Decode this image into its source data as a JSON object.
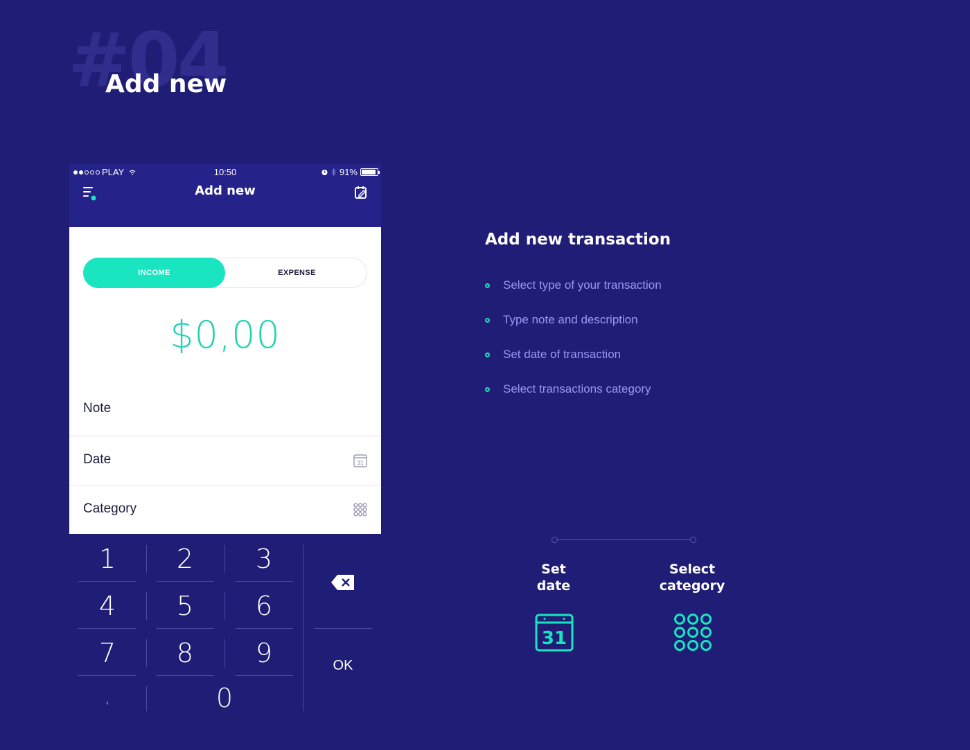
{
  "header": {
    "background_number": "#04",
    "title": "Add new"
  },
  "phone": {
    "status": {
      "carrier": "PLAY",
      "time": "10:50",
      "battery": "91%"
    },
    "nav_title": "Add new",
    "toggle": {
      "income": "INCOME",
      "expense": "EXPENSE",
      "selected": "INCOME"
    },
    "amount": "$0,00",
    "fields": {
      "note": "Note",
      "date": "Date",
      "category": "Category"
    },
    "date_icon_day": "31",
    "keypad": {
      "k1": "1",
      "k2": "2",
      "k3": "3",
      "k4": "4",
      "k5": "5",
      "k6": "6",
      "k7": "7",
      "k8": "8",
      "k9": "9",
      "comma": ",",
      "k0": "0",
      "ok": "OK"
    }
  },
  "info": {
    "title": "Add new transaction",
    "bullets": [
      "Select type of your transaction",
      "Type note and description",
      "Set date of transaction",
      "Select transactions category"
    ]
  },
  "steps": {
    "date": {
      "line1": "Set",
      "line2": "date",
      "icon_day": "31"
    },
    "category": {
      "line1": "Select",
      "line2": "category"
    }
  },
  "colors": {
    "background": "#1f1d75",
    "accent": "#19e6c1",
    "bullet_text": "#9a98f5"
  }
}
